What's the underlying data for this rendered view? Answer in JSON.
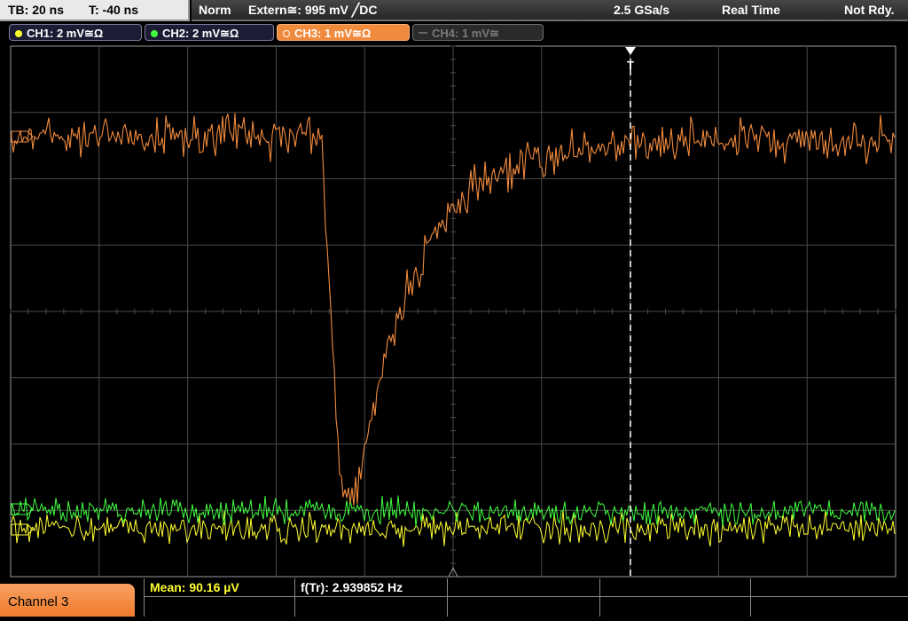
{
  "topbar": {
    "timebase": "TB: 20 ns",
    "trigger_time": "T: -40 ns",
    "mode": "Norm",
    "trigger": "Extern≅: 995 mV ╱DC",
    "sample_rate": "2.5 GSa/s",
    "acquisition": "Real Time",
    "state": "Not Rdy."
  },
  "channels": [
    {
      "label": "CH1: 2 mV≅Ω",
      "color": "#ffff30"
    },
    {
      "label": "CH2: 2 mV≅Ω",
      "color": "#40ff40"
    },
    {
      "label": "CH3: 1 mV≅Ω",
      "color": "#f08a3c"
    },
    {
      "label": "CH4: 1 mV≅",
      "color": "#777777"
    }
  ],
  "markers": {
    "trigger": "T"
  },
  "bottom": {
    "channel_label": "Channel 3",
    "mean": "Mean: 90.16 µV",
    "frequency": "f(Tr): 2.939852 Hz"
  },
  "colors": {
    "grid": "#4a4a4a",
    "ch1": "#ffff30",
    "ch2": "#40ff40",
    "ch3": "#f08a3c"
  }
}
